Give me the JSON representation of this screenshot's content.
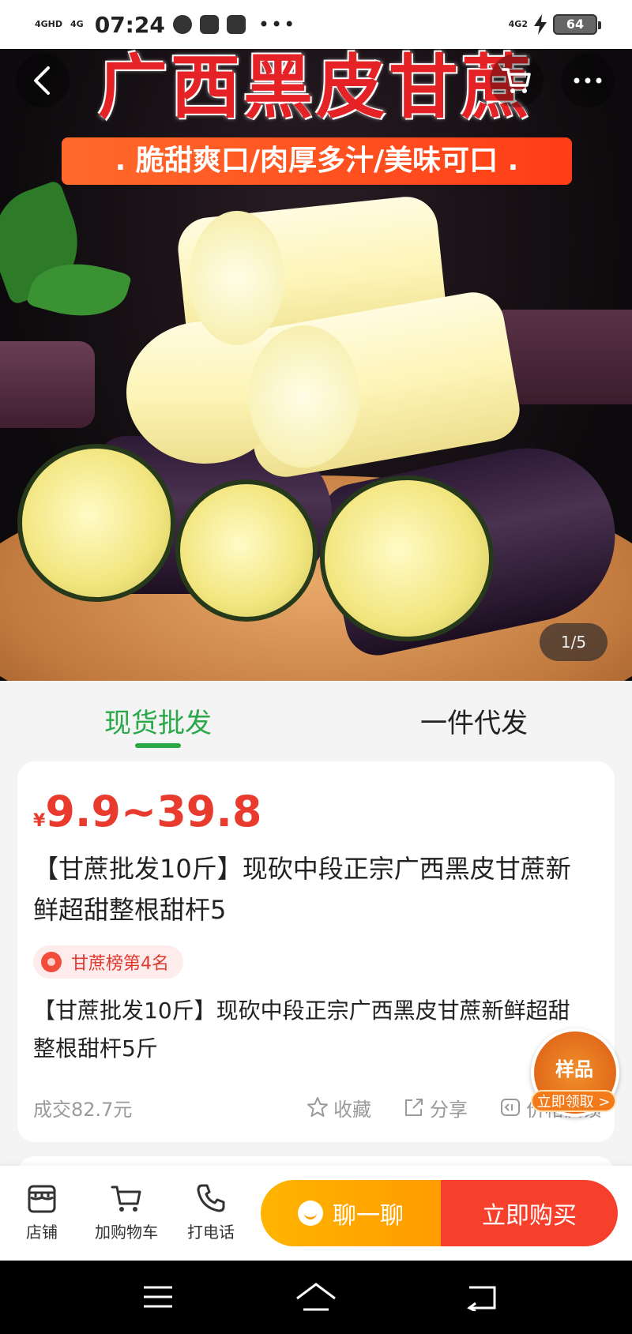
{
  "status_bar": {
    "signal_1": "4GHD",
    "signal_2": "4G",
    "time": "07:24",
    "right_network": "4G2",
    "battery": "64"
  },
  "hero": {
    "title_overlay": "广西黑皮甘蔗",
    "banner_text": ". 脆甜爽口/肉厚多汁/美味可口 .",
    "page_indicator": "1/5"
  },
  "tabs": [
    {
      "label": "现货批发",
      "active": true
    },
    {
      "label": "一件代发",
      "active": false
    }
  ],
  "product": {
    "currency": "¥",
    "price_range": "9.9~39.8",
    "title": "【甘蔗批发10斤】现砍中段正宗广西黑皮甘蔗新鲜超甜整根甜杆5",
    "rank_badge": "甘蔗榜第4名",
    "description": "【甘蔗批发10斤】现砍中段正宗广西黑皮甘蔗新鲜超甜整根甜杆5斤",
    "deal_amount": "成交82.7元",
    "favorite_label": "收藏",
    "share_label": "分享",
    "price_feedback_label": "价格反馈"
  },
  "sample_float": {
    "label": "样品",
    "claim": "立即领取 >"
  },
  "bottom_bar": {
    "shop_label": "店铺",
    "cart_label": "加购物车",
    "call_label": "打电话",
    "chat_label": "聊一聊",
    "buy_label": "立即购买"
  },
  "colors": {
    "accent_green": "#2aa84a",
    "price_red": "#e83b2e",
    "chat_orange": "#ffa800",
    "buy_red": "#f7402c"
  }
}
